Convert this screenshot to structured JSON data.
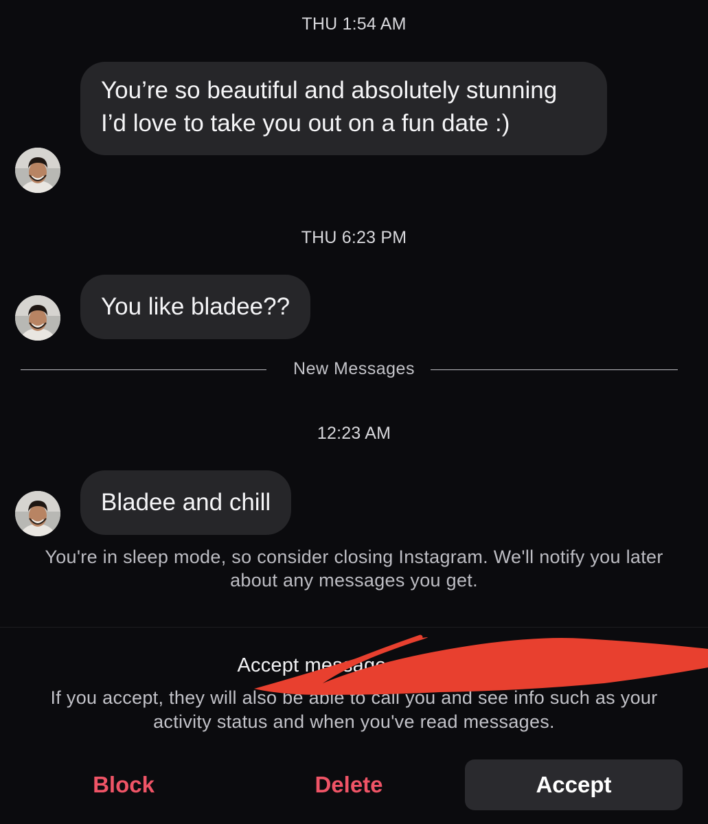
{
  "thread": {
    "messages": [
      {
        "timestamp": "THU 1:54 AM",
        "text": "You’re so beautiful and absolutely stunning I’d love to take you out on a fun date :)"
      },
      {
        "timestamp": "THU 6:23 PM",
        "text": "You like bladee??"
      },
      {
        "timestamp": "12:23 AM",
        "text": "Bladee and chill"
      }
    ],
    "new_messages_label": "New Messages",
    "sleep_mode_notice": "You're in sleep mode, so consider closing Instagram. We'll notify you later about any messages you get."
  },
  "request": {
    "title": "Accept message request f",
    "description": "If you accept, they will also be able to call you and see info such as your activity status and when you've read messages.",
    "redaction_color": "#e8402f"
  },
  "actions": {
    "block_label": "Block",
    "delete_label": "Delete",
    "accept_label": "Accept",
    "destructive_color": "#ef5466"
  },
  "icons": {
    "sender_avatar": "profile-photo-avatar"
  }
}
